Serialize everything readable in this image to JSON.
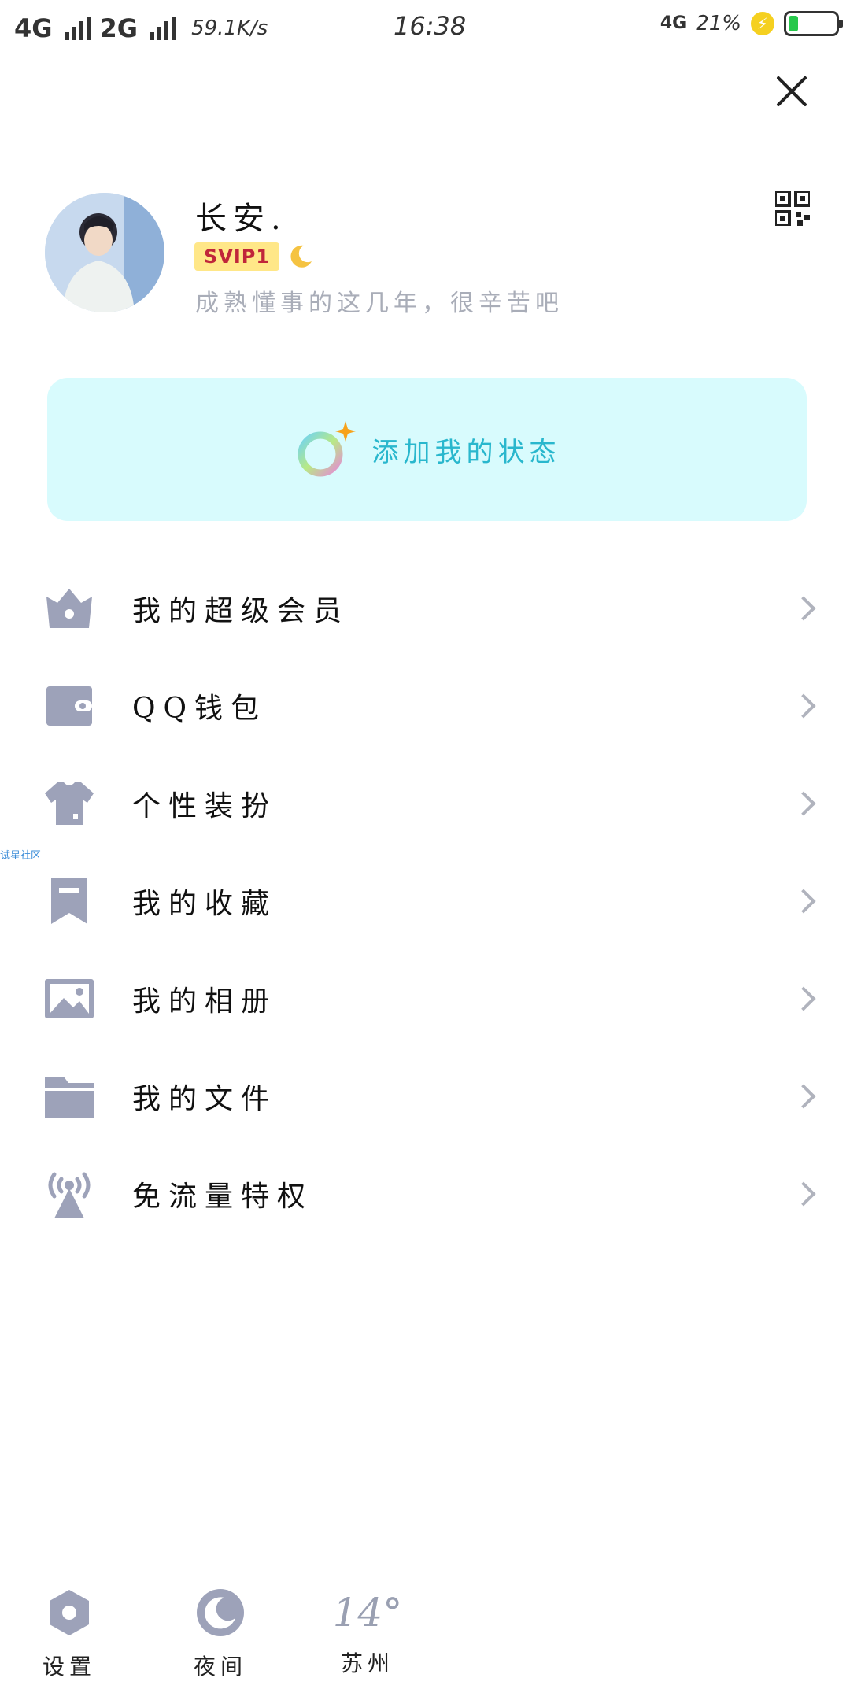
{
  "status_bar": {
    "net1": "4G",
    "net2": "2G",
    "speed": "59.1K/s",
    "time": "16:38",
    "net_small": "4G",
    "battery_pct": "21%",
    "battery_level": 0.21
  },
  "profile": {
    "nickname": "长安.",
    "vip": "SVIP1",
    "signature": "成熟懂事的这几年，很辛苦吧"
  },
  "status_card": {
    "label": "添加我的状态"
  },
  "menu": {
    "items": [
      {
        "label": "我的超级会员",
        "icon": "crown-icon"
      },
      {
        "label": "QQ钱包",
        "icon": "wallet-icon"
      },
      {
        "label": "个性装扮",
        "icon": "shirt-icon"
      },
      {
        "label": "我的收藏",
        "icon": "bookmark-icon"
      },
      {
        "label": "我的相册",
        "icon": "photo-icon"
      },
      {
        "label": "我的文件",
        "icon": "folder-icon"
      },
      {
        "label": "免流量特权",
        "icon": "antenna-icon"
      }
    ]
  },
  "side_tag": "试星社区",
  "bottom": {
    "settings_label": "设置",
    "night_label": "夜间",
    "weather_temp": "14°",
    "weather_city": "苏州"
  },
  "colors": {
    "icon_gray": "#9da2b9",
    "card_bg": "#d8fbfd",
    "accent_cyan": "#29b7cd",
    "vip_bg": "#ffe788",
    "vip_text": "#c0263a"
  }
}
